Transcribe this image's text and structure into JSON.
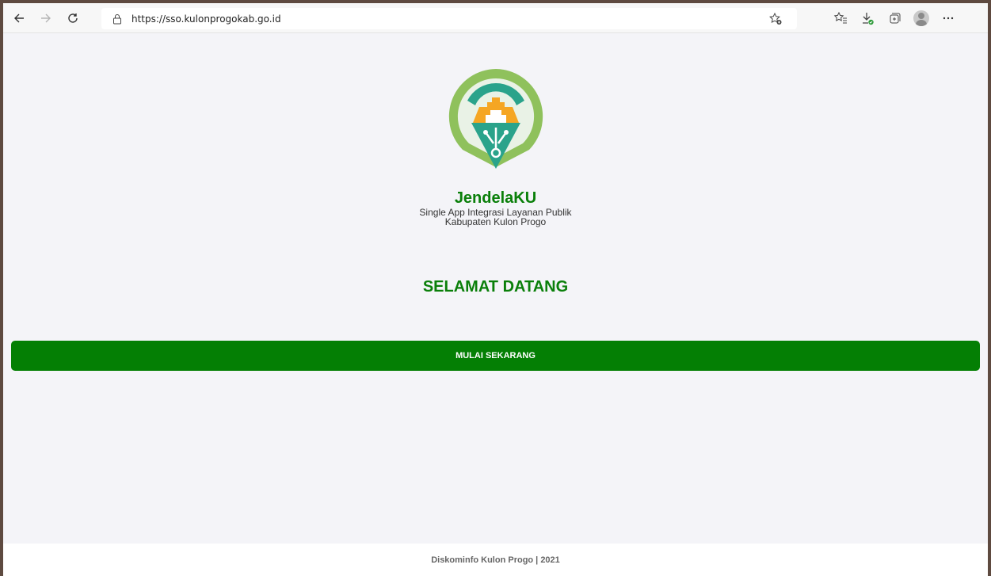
{
  "browser": {
    "url": "https://sso.kulonprogokab.go.id",
    "icons": [
      "back-icon",
      "forward-icon",
      "refresh-icon",
      "lock-icon",
      "favorite-add-icon",
      "favorites-icon",
      "downloads-icon",
      "collections-icon",
      "profile-icon",
      "more-icon"
    ]
  },
  "app": {
    "title": "JendelaKU",
    "subtitle_line1": "Single App Integrasi Layanan Publik",
    "subtitle_line2": "Kabupaten Kulon Progo",
    "welcome": "SELAMAT DATANG",
    "start_button": "MULAI SEKARANG",
    "footer": "Diskominfo Kulon Progo | 2021"
  },
  "colors": {
    "brand_green": "#047f04",
    "logo_light_green": "#8fc15c",
    "logo_teal": "#2aa38b",
    "logo_orange": "#f5a623"
  }
}
